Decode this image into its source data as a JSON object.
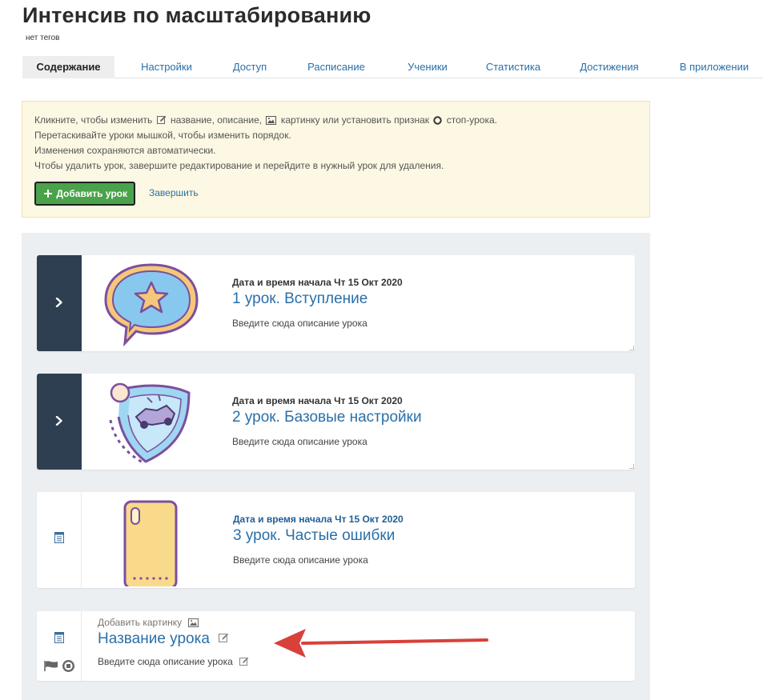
{
  "header": {
    "title": "Интенсив по масштабированию",
    "tags": "нет тегов"
  },
  "tabs": [
    {
      "label": "Содержание",
      "active": true
    },
    {
      "label": "Настройки"
    },
    {
      "label": "Доступ"
    },
    {
      "label": "Расписание"
    },
    {
      "label": "Ученики"
    },
    {
      "label": "Статистика"
    },
    {
      "label": "Достижения"
    },
    {
      "label": "В приложении"
    }
  ],
  "notice": {
    "line1_a": "Кликните, чтобы изменить",
    "line1_b": "название, описание,",
    "line1_c": "картинку или установить признак",
    "line1_d": "стоп-урока.",
    "line2": "Перетаскивайте уроки мышкой, чтобы изменить порядок.",
    "line3": "Изменения сохраняются автоматически.",
    "line4": "Чтобы удалить урок, завершите редактирование и перейдите в нужный урок для удаления.",
    "add_button": "Добавить урок",
    "finish_link": "Завершить"
  },
  "lessons": [
    {
      "date": "Дата и время начала Чт 15 Окт 2020",
      "title": "1 урок. Вступление",
      "description": "Введите сюда описание урока",
      "image": "star-speech-bubble",
      "side_icon": "chevron-right-icon"
    },
    {
      "date": "Дата и время начала Чт 15 Окт 2020",
      "title": "2 урок. Базовые настройки",
      "description": "Введите сюда описание урока",
      "image": "rocket-league-shield",
      "side_icon": "chevron-right-icon"
    },
    {
      "date": "Дата и время начала Чт 15 Окт 2020",
      "title": "3 урок. Частые ошибки",
      "description": "Введите сюда описание урока",
      "image": "yellow-phone",
      "side_icon": "document-icon"
    }
  ],
  "new_lesson": {
    "add_image": "Добавить картинку",
    "title": "Название урока",
    "description": "Введите сюда описание урока"
  },
  "colors": {
    "accent_blue": "#2a6fa8",
    "dark_side": "#2f3f52",
    "success_green": "#4aa34a",
    "notice_bg": "#fcf8e3",
    "annotation_red": "#d8413a"
  }
}
